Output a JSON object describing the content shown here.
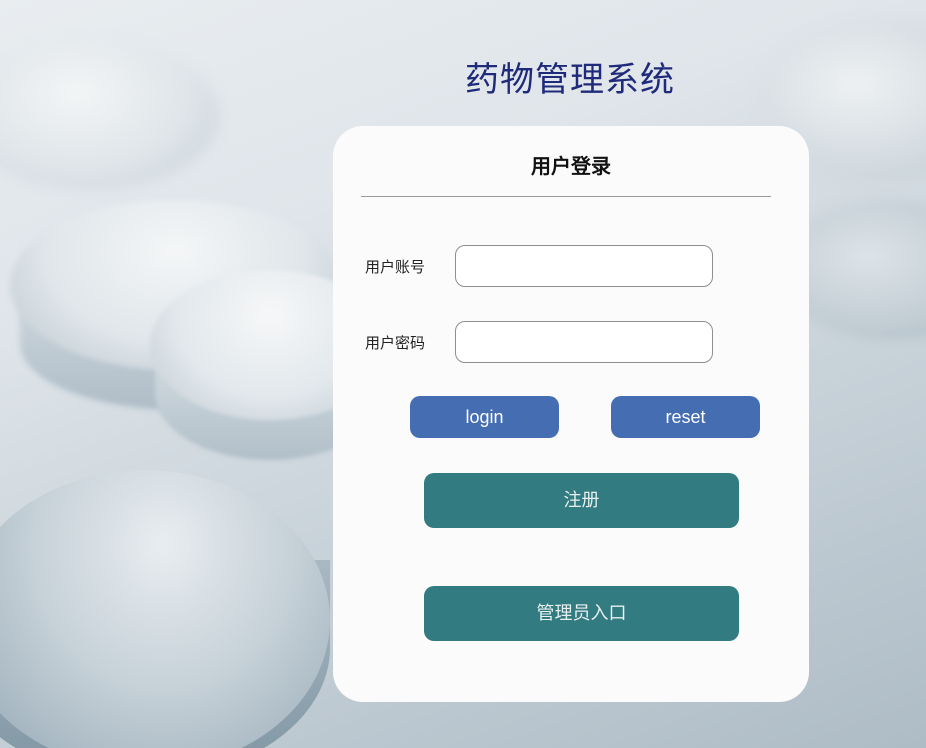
{
  "header": {
    "system_title": "药物管理系统"
  },
  "login_card": {
    "title": "用户登录",
    "account": {
      "label": "用户账号",
      "value": "",
      "placeholder": ""
    },
    "password": {
      "label": "用户密码",
      "value": "",
      "placeholder": ""
    },
    "login_label": "login",
    "reset_label": "reset",
    "register_label": "注册",
    "admin_label": "管理员入口"
  },
  "colors": {
    "title": "#1f2a7a",
    "primary_button": "#446db2",
    "secondary_button": "#327b80",
    "card_background": "#fbfbfc"
  }
}
